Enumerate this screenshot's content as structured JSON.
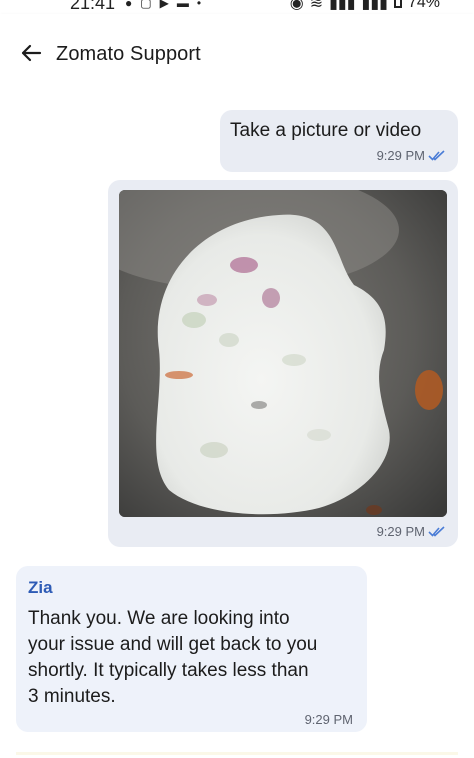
{
  "status_bar": {
    "time": "21:41",
    "battery": "74%"
  },
  "header": {
    "title": "Zomato Support",
    "back_icon": "arrow-left-icon"
  },
  "messages": [
    {
      "direction": "outgoing",
      "text": "Take a picture or video",
      "time": "9:29 PM",
      "status_icon": "double-check-icon"
    },
    {
      "direction": "outgoing",
      "type": "image",
      "time": "9:29 PM",
      "status_icon": "double-check-icon"
    },
    {
      "direction": "incoming",
      "sender": "Zia",
      "text_lines": [
        "Thank you. We are looking into",
        "your issue and will get back to you",
        "shortly. It typically takes less than",
        "3 minutes."
      ],
      "time": "9:29 PM"
    }
  ],
  "colors": {
    "accent": "#2d5bb5",
    "outgoing_bubble": "#e9ecf3",
    "incoming_bubble": "#eef2fa",
    "tick": "#4a7cd6"
  }
}
